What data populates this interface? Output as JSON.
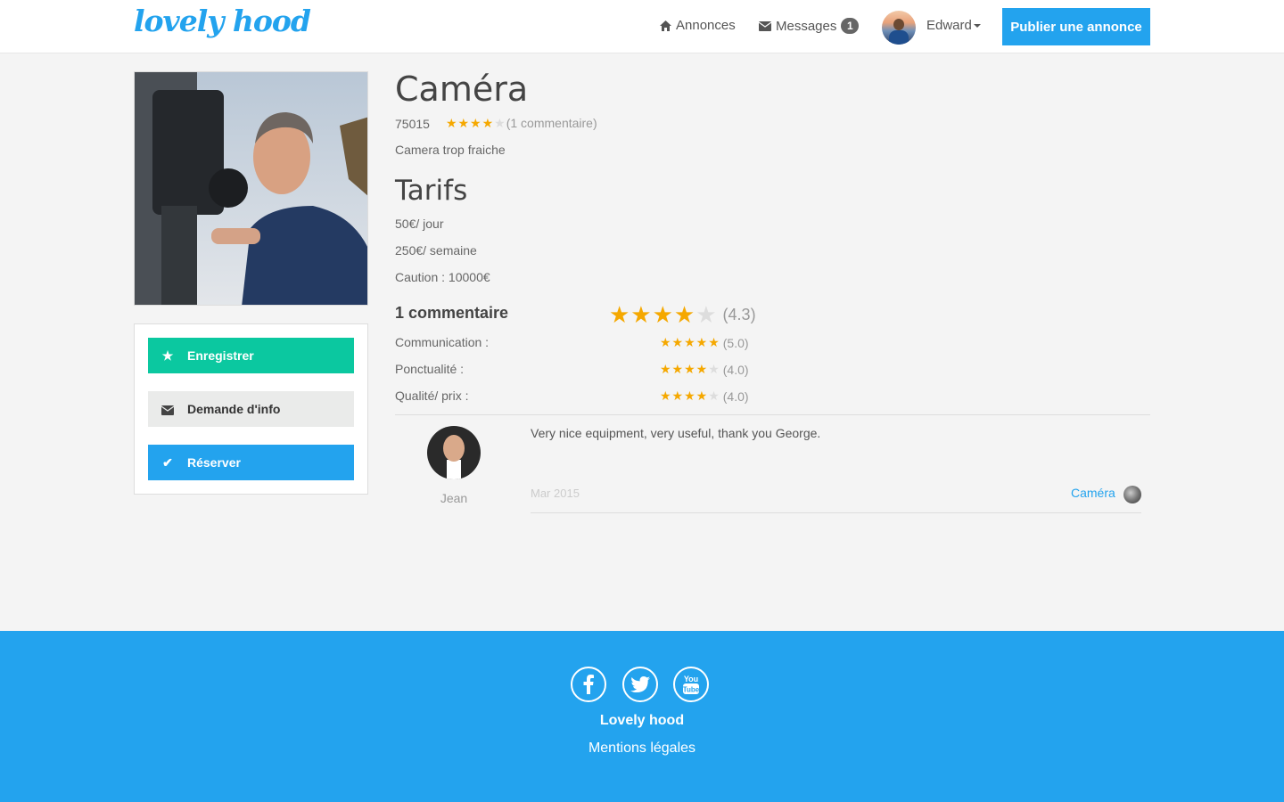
{
  "header": {
    "logo": "lovely hood",
    "nav": {
      "annonces": "Annonces",
      "messages": "Messages",
      "messages_count": "1"
    },
    "user_name": "Edward",
    "publish_label": "Publier une annonce"
  },
  "actions": {
    "save_label": "Enregistrer",
    "info_label": "Demande d'info",
    "book_label": "Réserver"
  },
  "listing": {
    "title": "Caméra",
    "postcode": "75015",
    "rating": 4,
    "comments_link": "(1 commentaire)",
    "description": "Camera trop fraiche",
    "tarifs_title": "Tarifs",
    "price_day": "50€/ jour",
    "price_week": "250€/ semaine",
    "deposit": "Caution : 10000€"
  },
  "reviews": {
    "title": "1 commentaire",
    "overall_score": "(4.3)",
    "overall_stars": 4,
    "criteria": [
      {
        "label": "Communication :",
        "score": "(5.0)",
        "stars": 5
      },
      {
        "label": "Ponctualité :",
        "score": "(4.0)",
        "stars": 4
      },
      {
        "label": "Qualité/ prix :",
        "score": "(4.0)",
        "stars": 4
      }
    ],
    "items": [
      {
        "author": "Jean",
        "text": "Very nice equipment, very useful, thank you George.",
        "date": "Mar 2015",
        "item": "Caméra"
      }
    ]
  },
  "footer": {
    "brand": "Lovely hood",
    "legal": "Mentions légales"
  },
  "colors": {
    "primary": "#23a3ee",
    "green": "#0bc8a0",
    "star": "#f5a800"
  }
}
